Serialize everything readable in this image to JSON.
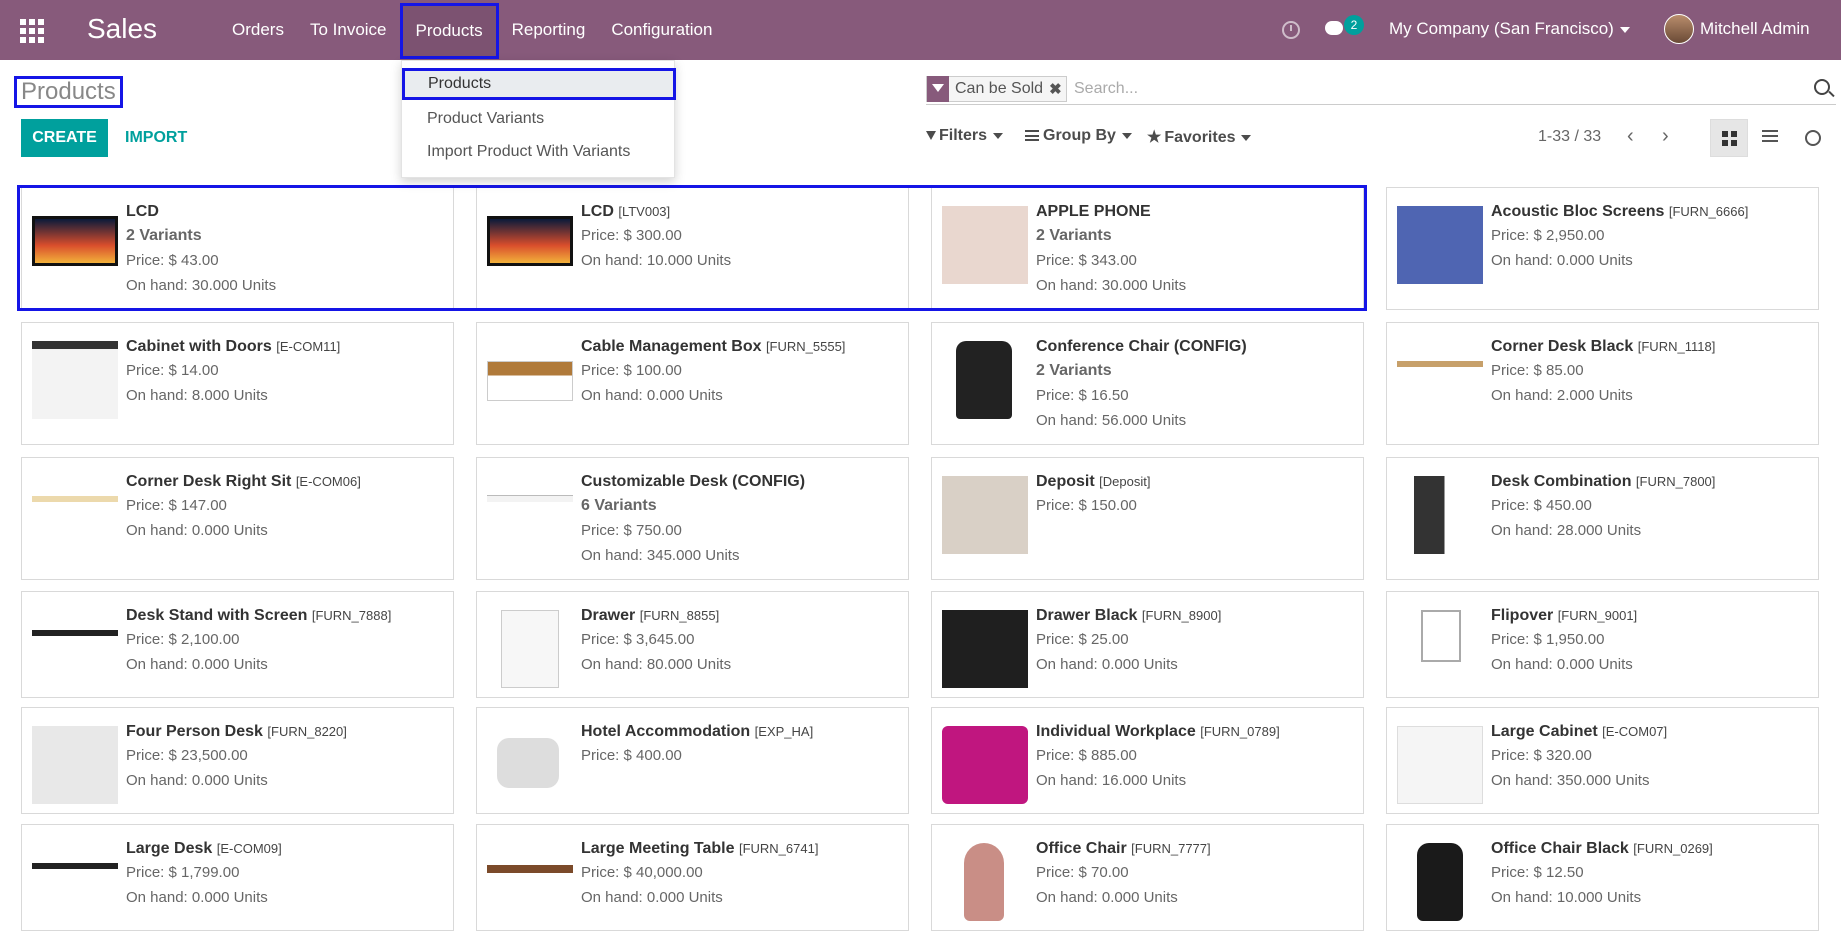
{
  "app": {
    "name": "Sales"
  },
  "menu": [
    "Orders",
    "To Invoice",
    "Products",
    "Reporting",
    "Configuration"
  ],
  "notifications": {
    "messages_count": "2"
  },
  "company": "My Company (San Francisco)",
  "user": "Mitchell Admin",
  "products_dropdown": [
    "Products",
    "Product Variants",
    "Import Product With Variants"
  ],
  "page": {
    "title": "Products"
  },
  "buttons": {
    "create": "CREATE",
    "import": "IMPORT"
  },
  "search": {
    "facet": "Can be Sold",
    "placeholder": "Search..."
  },
  "search_panel": {
    "filters": "Filters",
    "group_by": "Group By",
    "favorites": "Favorites"
  },
  "pager": {
    "value": "1-33 / 33"
  },
  "products": [
    {
      "name": "LCD",
      "ref": "",
      "variants": "2 Variants",
      "price": "Price: $ 43.00",
      "onhand": "On hand: 30.000 Units",
      "thumb": "monitor"
    },
    {
      "name": "LCD",
      "ref": "[LTV003]",
      "variants": "",
      "price": "Price: $ 300.00",
      "onhand": "On hand: 10.000 Units",
      "thumb": "monitor"
    },
    {
      "name": "APPLE PHONE",
      "ref": "",
      "variants": "2 Variants",
      "price": "Price: $ 343.00",
      "onhand": "On hand: 30.000 Units",
      "thumb": "phone"
    },
    {
      "name": "Acoustic Bloc Screens",
      "ref": "[FURN_6666]",
      "variants": "",
      "price": "Price: $ 2,950.00",
      "onhand": "On hand: 0.000 Units",
      "thumb": "screen"
    },
    {
      "name": "Cabinet with Doors",
      "ref": "[E-COM11]",
      "variants": "",
      "price": "Price: $ 14.00",
      "onhand": "On hand: 8.000 Units",
      "thumb": "cabinet"
    },
    {
      "name": "Cable Management Box",
      "ref": "[FURN_5555]",
      "variants": "",
      "price": "Price: $ 100.00",
      "onhand": "On hand: 0.000 Units",
      "thumb": "cable"
    },
    {
      "name": "Conference Chair (CONFIG)",
      "ref": "",
      "variants": "2 Variants",
      "price": "Price: $ 16.50",
      "onhand": "On hand: 56.000 Units",
      "thumb": "chair"
    },
    {
      "name": "Corner Desk Black",
      "ref": "[FURN_1118]",
      "variants": "",
      "price": "Price: $ 85.00",
      "onhand": "On hand: 2.000 Units",
      "thumb": "desk"
    },
    {
      "name": "Corner Desk Right Sit",
      "ref": "[E-COM06]",
      "variants": "",
      "price": "Price: $ 147.00",
      "onhand": "On hand: 0.000 Units",
      "thumb": "desk2"
    },
    {
      "name": "Customizable Desk (CONFIG)",
      "ref": "",
      "variants": "6 Variants",
      "price": "Price: $ 750.00",
      "onhand": "On hand: 345.000 Units",
      "thumb": "desk3"
    },
    {
      "name": "Deposit",
      "ref": "[Deposit]",
      "variants": "",
      "price": "Price: $ 150.00",
      "onhand": "",
      "thumb": "hand"
    },
    {
      "name": "Desk Combination",
      "ref": "[FURN_7800]",
      "variants": "",
      "price": "Price: $ 450.00",
      "onhand": "On hand: 28.000 Units",
      "thumb": "combo"
    },
    {
      "name": "Desk Stand with Screen",
      "ref": "[FURN_7888]",
      "variants": "",
      "price": "Price: $ 2,100.00",
      "onhand": "On hand: 0.000 Units",
      "thumb": "black-desk"
    },
    {
      "name": "Drawer",
      "ref": "[FURN_8855]",
      "variants": "",
      "price": "Price: $ 3,645.00",
      "onhand": "On hand: 80.000 Units",
      "thumb": "drawer"
    },
    {
      "name": "Drawer Black",
      "ref": "[FURN_8900]",
      "variants": "",
      "price": "Price: $ 25.00",
      "onhand": "On hand: 0.000 Units",
      "thumb": "drawer-black"
    },
    {
      "name": "Flipover",
      "ref": "[FURN_9001]",
      "variants": "",
      "price": "Price: $ 1,950.00",
      "onhand": "On hand: 0.000 Units",
      "thumb": "flip"
    },
    {
      "name": "Four Person Desk",
      "ref": "[FURN_8220]",
      "variants": "",
      "price": "Price: $ 23,500.00",
      "onhand": "On hand: 0.000 Units",
      "thumb": "office"
    },
    {
      "name": "Hotel Accommodation",
      "ref": "[EXP_HA]",
      "variants": "",
      "price": "Price: $ 400.00",
      "onhand": "",
      "thumb": "camera"
    },
    {
      "name": "Individual Workplace",
      "ref": "[FURN_0789]",
      "variants": "",
      "price": "Price: $ 885.00",
      "onhand": "On hand: 16.000 Units",
      "thumb": "magenta"
    },
    {
      "name": "Large Cabinet",
      "ref": "[E-COM07]",
      "variants": "",
      "price": "Price: $ 320.00",
      "onhand": "On hand: 350.000 Units",
      "thumb": "large-cab"
    },
    {
      "name": "Large Desk",
      "ref": "[E-COM09]",
      "variants": "",
      "price": "Price: $ 1,799.00",
      "onhand": "On hand: 0.000 Units",
      "thumb": "black-desk"
    },
    {
      "name": "Large Meeting Table",
      "ref": "[FURN_6741]",
      "variants": "",
      "price": "Price: $ 40,000.00",
      "onhand": "On hand: 0.000 Units",
      "thumb": "meeting"
    },
    {
      "name": "Office Chair",
      "ref": "[FURN_7777]",
      "variants": "",
      "price": "Price: $ 70.00",
      "onhand": "On hand: 0.000 Units",
      "thumb": "pink-chair"
    },
    {
      "name": "Office Chair Black",
      "ref": "[FURN_0269]",
      "variants": "",
      "price": "Price: $ 12.50",
      "onhand": "On hand: 10.000 Units",
      "thumb": "black-chair"
    }
  ]
}
